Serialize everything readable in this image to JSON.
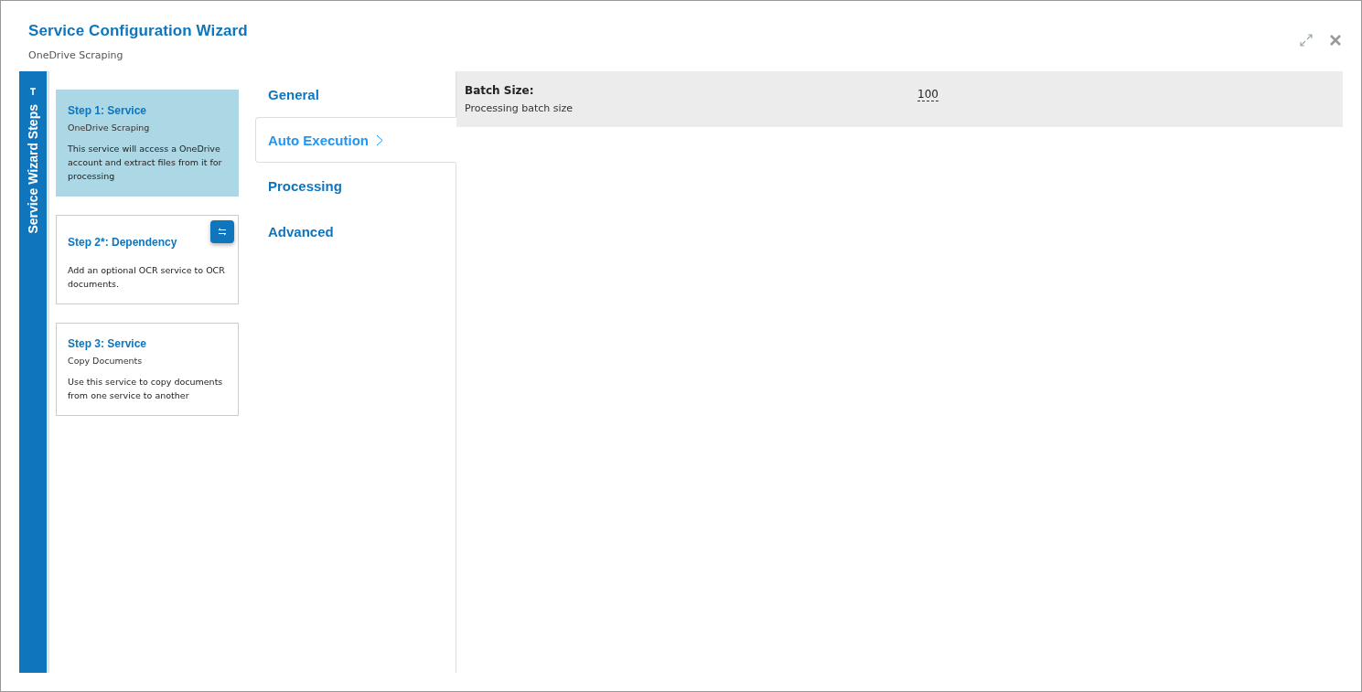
{
  "window": {
    "title": "Service Configuration Wizard",
    "subtitle": "OneDrive Scraping"
  },
  "sidebar": {
    "label": "Service Wizard Steps"
  },
  "steps": [
    {
      "title": "Step 1: Service",
      "subtitle": "OneDrive Scraping",
      "description": "This service will access a OneDrive account and extract files from it for processing",
      "selected": true,
      "swap_button": false
    },
    {
      "title": "Step 2*: Dependency",
      "description": "Add an optional OCR service to OCR documents.",
      "selected": false,
      "swap_button": true
    },
    {
      "title": "Step 3: Service",
      "subtitle": "Copy Documents",
      "description": "Use this service to copy documents from one service to another",
      "selected": false,
      "swap_button": false
    }
  ],
  "tabs": [
    {
      "label": "General",
      "selected": false
    },
    {
      "label": "Auto Execution",
      "selected": true
    },
    {
      "label": "Processing",
      "selected": false
    },
    {
      "label": "Advanced",
      "selected": false
    }
  ],
  "settings": [
    {
      "label": "Batch Size:",
      "description": "Processing batch size",
      "value": "100"
    }
  ]
}
